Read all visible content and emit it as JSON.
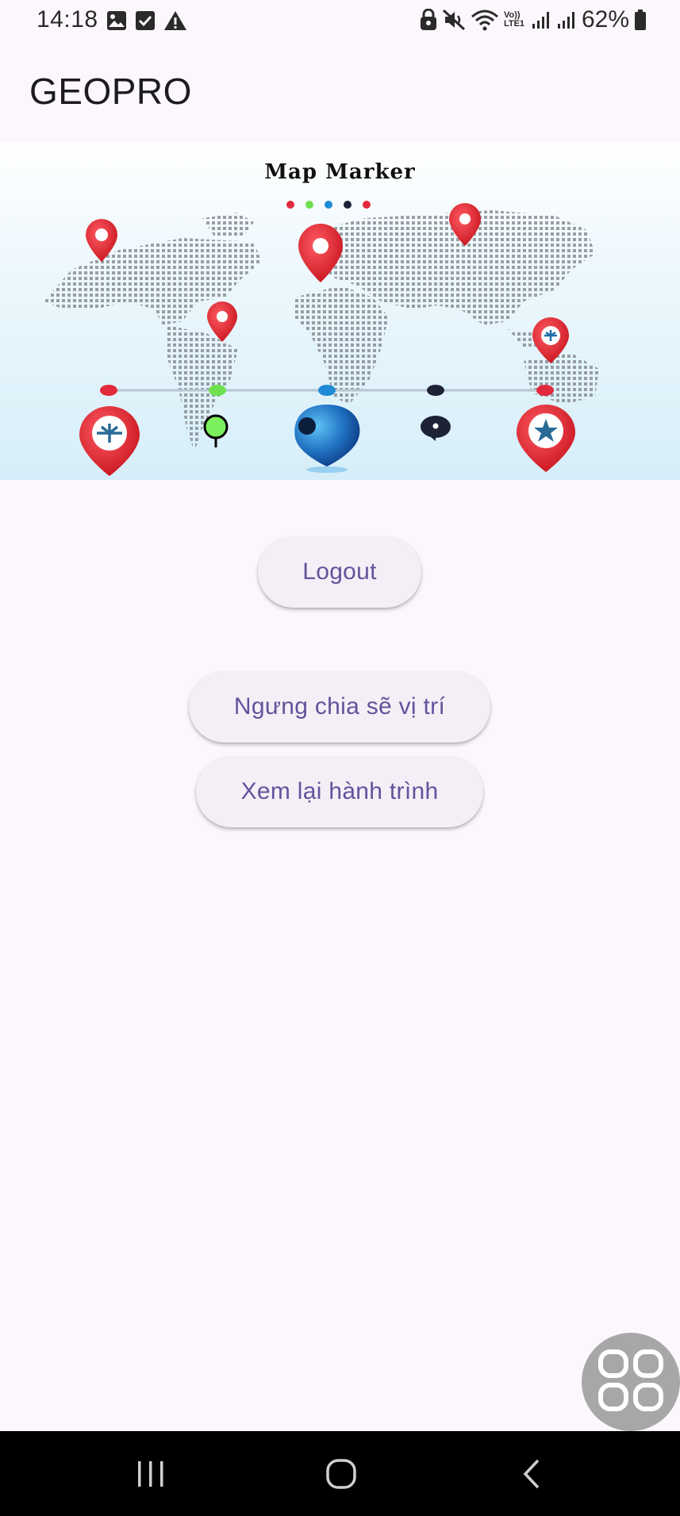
{
  "status_bar": {
    "time": "14:18",
    "battery_percent": "62%",
    "left_icons": [
      "image-icon",
      "checkbox-icon",
      "warning-icon"
    ],
    "right_icons": [
      "lock-icon",
      "mute-icon",
      "wifi-icon",
      "volte-icon",
      "signal-icon",
      "signal-icon",
      "battery-icon"
    ],
    "volte_label": "Vo)) LTE1"
  },
  "app_bar": {
    "title": "GEOPRO"
  },
  "banner": {
    "title": "Map Marker",
    "marker_colors": [
      "#e12a3c",
      "#6ee04f",
      "#1f8ad6",
      "#1e2236",
      "#e12a3c"
    ]
  },
  "actions": {
    "logout_label": "Logout",
    "stop_sharing_label": "Ngưng chia sẽ vị trí",
    "review_trip_label": "Xem lại hành trình"
  },
  "nav_bar": {
    "icons": [
      "recent-apps-icon",
      "home-icon",
      "back-icon"
    ]
  },
  "colors": {
    "background": "#fcf7fc",
    "button_bg": "#f4eff6",
    "button_text": "#66519c"
  }
}
